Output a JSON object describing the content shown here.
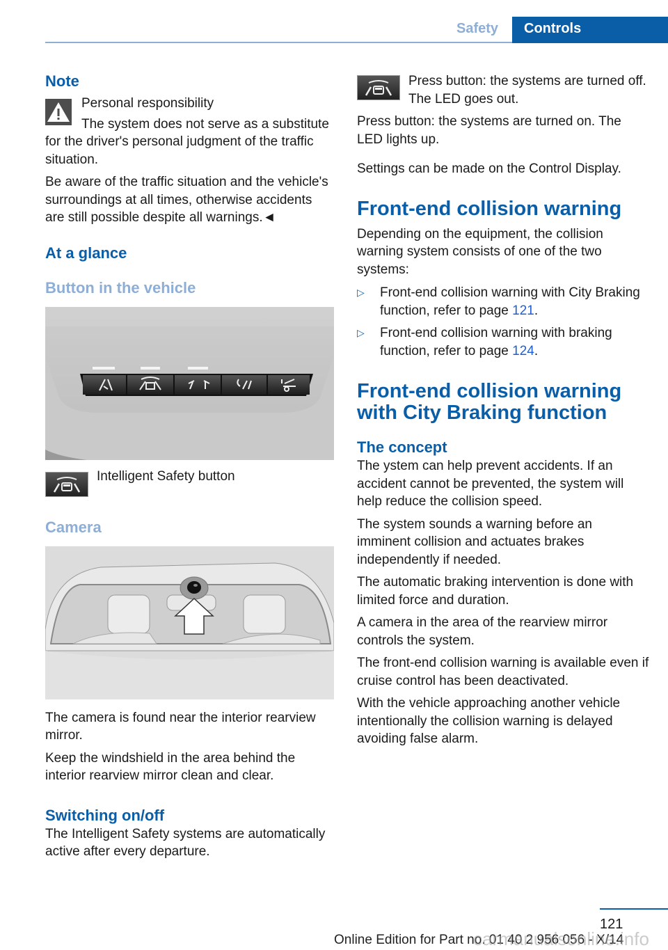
{
  "header": {
    "section": "Safety",
    "chapter": "Controls"
  },
  "left": {
    "note": {
      "title": "Note",
      "warning_title": "Personal responsibility",
      "p1": "The system does not serve as a substitute for the driver's personal judgment of the traffic situation.",
      "p2": "Be aware of the traffic situation and the vehicle's surroundings at all times, otherwise accidents are still possible despite all warnings.◄"
    },
    "at_a_glance": "At a glance",
    "button_heading": "Button in the vehicle",
    "figure_buttons": [
      "lane-departure-icon",
      "intelligent-safety-icon",
      "collision-warning-icon",
      "lane-change-icon",
      "parking-icon"
    ],
    "button_caption": "Intelligent Safety button",
    "camera_heading": "Camera",
    "camera_p1": "The camera is found near the interior rearview mirror.",
    "camera_p2": "Keep the windshield in the area behind the interior rearview mirror clean and clear.",
    "switching_heading": "Switching on/off",
    "switching_p1": "The Intelligent Safety systems are automatically active after every departure."
  },
  "right": {
    "press_off": "Press button: the systems are turned off. The LED goes out.",
    "press_on": "Press button: the systems are turned on. The LED lights up.",
    "settings": "Settings can be made on the Control Display.",
    "fcw_heading": "Front-end collision warning",
    "fcw_intro": "Depending on the equipment, the collision warning system consists of one of the two systems:",
    "fcw_list": [
      {
        "text": "Front-end collision warning with City Braking function, refer to page ",
        "page": "121"
      },
      {
        "text": "Front-end collision warning with braking function, refer to page ",
        "page": "124"
      }
    ],
    "city_heading": "Front-end collision warning with City Braking function",
    "concept_heading": "The concept",
    "concept_paras": [
      "The ystem can help prevent accidents. If an accident cannot be prevented, the system will help reduce the collision speed.",
      "The system sounds a warning before an imminent collision and actuates brakes independently if needed.",
      "The automatic braking intervention is done with limited force and duration.",
      "A camera in the area of the rearview mirror controls the system.",
      "The front-end collision warning is available even if cruise control has been deactivated.",
      "With the vehicle approaching another vehicle intentionally the collision warning is delayed avoiding false alarm."
    ]
  },
  "footer": {
    "page_number": "121",
    "edition": "Online Edition for Part no. 01 40 2 956 056 - X/14",
    "watermark": "carmanualsonline.info"
  }
}
